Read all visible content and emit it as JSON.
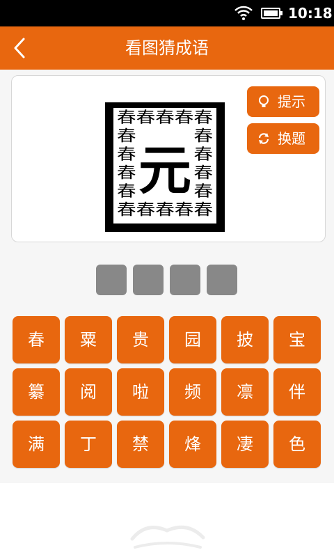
{
  "status_bar": {
    "time": "10:18"
  },
  "app_bar": {
    "title": "看图猜成语",
    "back_icon": "chevron-left-icon"
  },
  "puzzle": {
    "outer_char": "囗",
    "center_char": "元",
    "repeated_char": "春",
    "border_rows": [
      "春春春春春",
      "春　　　春",
      "春　　　春",
      "春　　　春",
      "春　　　春",
      "春春春春春"
    ]
  },
  "buttons": {
    "hint": {
      "label": "提示",
      "icon": "lightbulb-icon"
    },
    "switch": {
      "label": "换题",
      "icon": "refresh-icon"
    }
  },
  "answer_slots": [
    "",
    "",
    "",
    ""
  ],
  "keys": [
    "春",
    "粟",
    "贵",
    "园",
    "披",
    "宝",
    "纂",
    "阅",
    "啦",
    "频",
    "凛",
    "伴",
    "满",
    "丁",
    "禁",
    "烽",
    "凄",
    "色"
  ],
  "colors": {
    "accent": "#e8670f",
    "slot": "#888888",
    "background": "#f6f6f6"
  }
}
